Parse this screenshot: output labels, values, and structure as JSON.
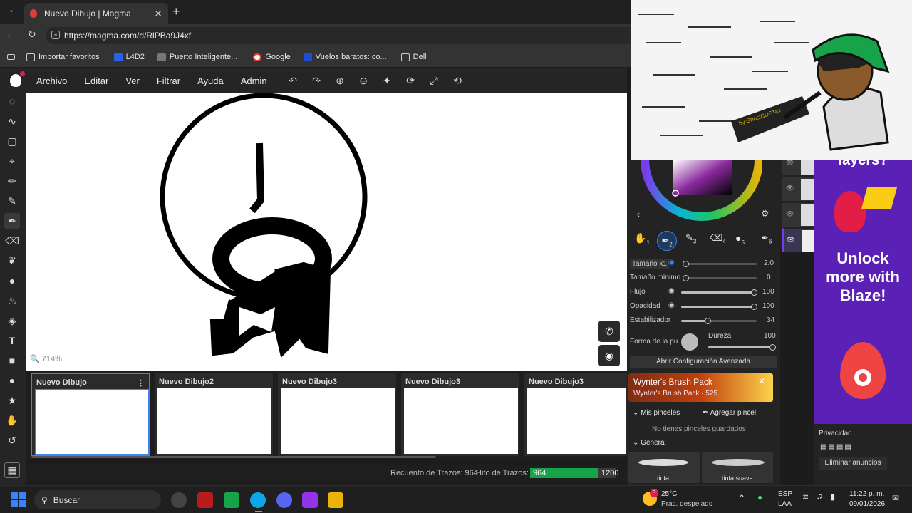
{
  "browser": {
    "tab_title": "Nuevo Dibujo | Magma",
    "url": "https://magma.com/d/RlPBa9J4xf",
    "bookmarks": [
      "Importar favoritos",
      "L4D2",
      "Puerto Inteligente...",
      "Google",
      "Vuelos baratos: co...",
      "Dell"
    ]
  },
  "menu": {
    "items": [
      "Archivo",
      "Editar",
      "Ver",
      "Filtrar",
      "Ayuda",
      "Admin"
    ]
  },
  "canvas": {
    "zoom": "714%"
  },
  "documents": [
    {
      "title": "Nuevo Dibujo",
      "active": true
    },
    {
      "title": "Nuevo Dibujo2",
      "active": false
    },
    {
      "title": "Nuevo Dibujo3",
      "active": false
    },
    {
      "title": "Nuevo Dibujo3",
      "active": false
    },
    {
      "title": "Nuevo Dibujo3",
      "active": false
    }
  ],
  "status": {
    "stroke_count_label": "Recuento de Trazos: 964",
    "stroke_goal_label": "Hito de Trazos:",
    "stroke_value": "964",
    "stroke_goal": "1200",
    "progress_fraction": 0.803
  },
  "brush_panel": {
    "brush_slots": [
      "1",
      "2",
      "3",
      "4",
      "5",
      "6"
    ],
    "size_label": "Tamaño x1",
    "size_value": "2.0",
    "min_size_label": "Tamaño mínimo",
    "min_size_value": "0",
    "flow_label": "Flujo",
    "flow_value": "100",
    "opacity_label": "Opacidad",
    "opacity_value": "100",
    "stabilizer_label": "Estabilizador",
    "stabilizer_value": "34",
    "tip_label": "Forma de la pu",
    "hardness_label": "Dureza",
    "hardness_value": "100",
    "advanced_button": "Abrir Configuración Avanzada",
    "pack_title": "Wynter's Brush Pack",
    "pack_sub": "Wynter's Brush Pack · 525",
    "my_brushes": "Mis pinceles",
    "add_brush": "Agregar pincel",
    "no_brushes": "No tienes pinceles guardados",
    "general": "General",
    "brush_names": [
      "tinta",
      "tinta suave"
    ]
  },
  "ad": {
    "top_text": "layers?",
    "headline": "Unlock more with Blaze!",
    "privacy": "Privacidad",
    "remove_ads": "Eliminar anuncios"
  },
  "overlay": {
    "caption": "by GhostCDSTax"
  },
  "taskbar": {
    "search": "Buscar",
    "weather_temp": "25°C",
    "weather_desc": "Prac. despejado",
    "weather_badge": "8",
    "lang": "ESP",
    "region": "LAA",
    "time": "11:22 p. m.",
    "date": "09/01/2026"
  },
  "colors": {
    "accent": "#3b82f6",
    "progress_green": "#16a34a",
    "ad_bg": "#5b21b6",
    "taskbar_bg": "#1f1f1f"
  }
}
